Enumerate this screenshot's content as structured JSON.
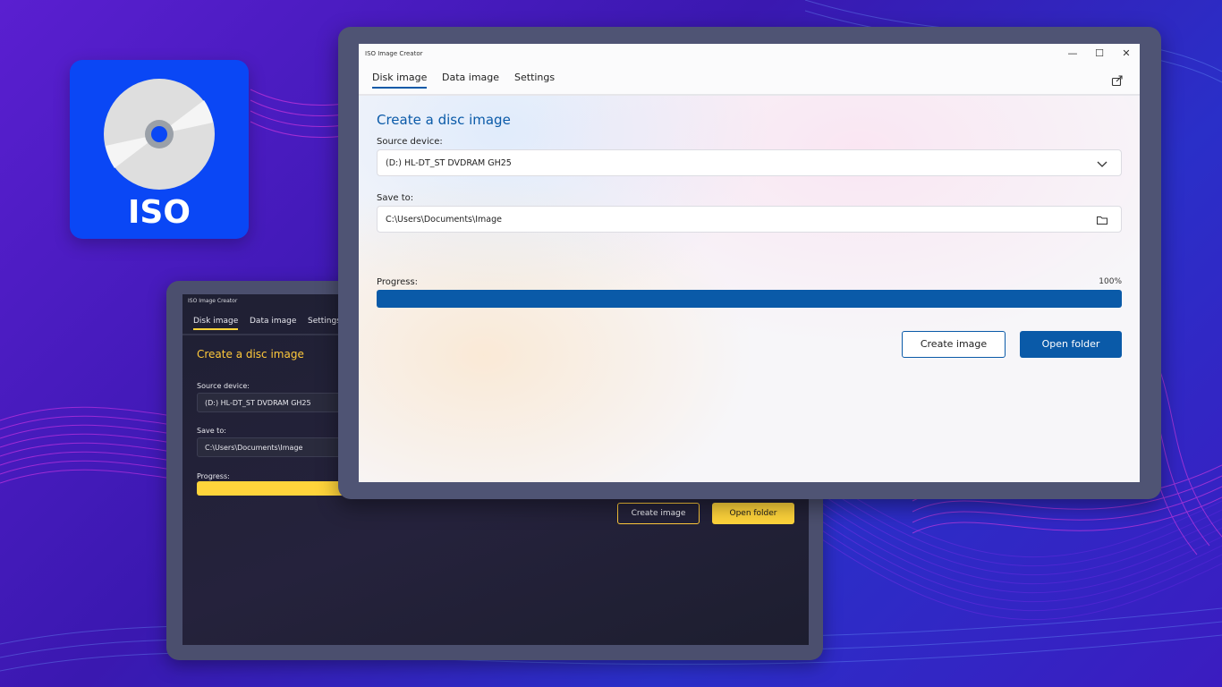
{
  "app_icon": {
    "text": "ISO"
  },
  "dark_window": {
    "title": "ISO Image Creator",
    "tabs": [
      {
        "label": "Disk image",
        "active": true
      },
      {
        "label": "Data image",
        "active": false
      },
      {
        "label": "Settings",
        "active": false
      }
    ],
    "heading": "Create a disc image",
    "source_label": "Source device:",
    "source_value": "(D:) HL-DT_ST DVDRAM GH25",
    "save_label": "Save to:",
    "save_value": "C:\\Users\\Documents\\Image",
    "progress_label": "Progress:",
    "create_button": "Create image",
    "open_button": "Open folder",
    "accent_color": "#ffd43b"
  },
  "light_window": {
    "title": "ISO Image Creator",
    "window_controls": {
      "minimize": "—",
      "maximize": "☐",
      "close": "✕"
    },
    "tabs": [
      {
        "label": "Disk image",
        "active": true
      },
      {
        "label": "Data image",
        "active": false
      },
      {
        "label": "Settings",
        "active": false
      }
    ],
    "share_icon": "share-icon",
    "heading": "Create a disc image",
    "source_label": "Source device:",
    "source_value": "(D:) HL-DT_ST DVDRAM GH25",
    "save_label": "Save to:",
    "save_value": "C:\\Users\\Documents\\Image",
    "progress_label": "Progress:",
    "progress_percent": "100%",
    "progress_value": 1.0,
    "create_button": "Create image",
    "open_button": "Open folder",
    "accent_color": "#0a5aa8"
  }
}
